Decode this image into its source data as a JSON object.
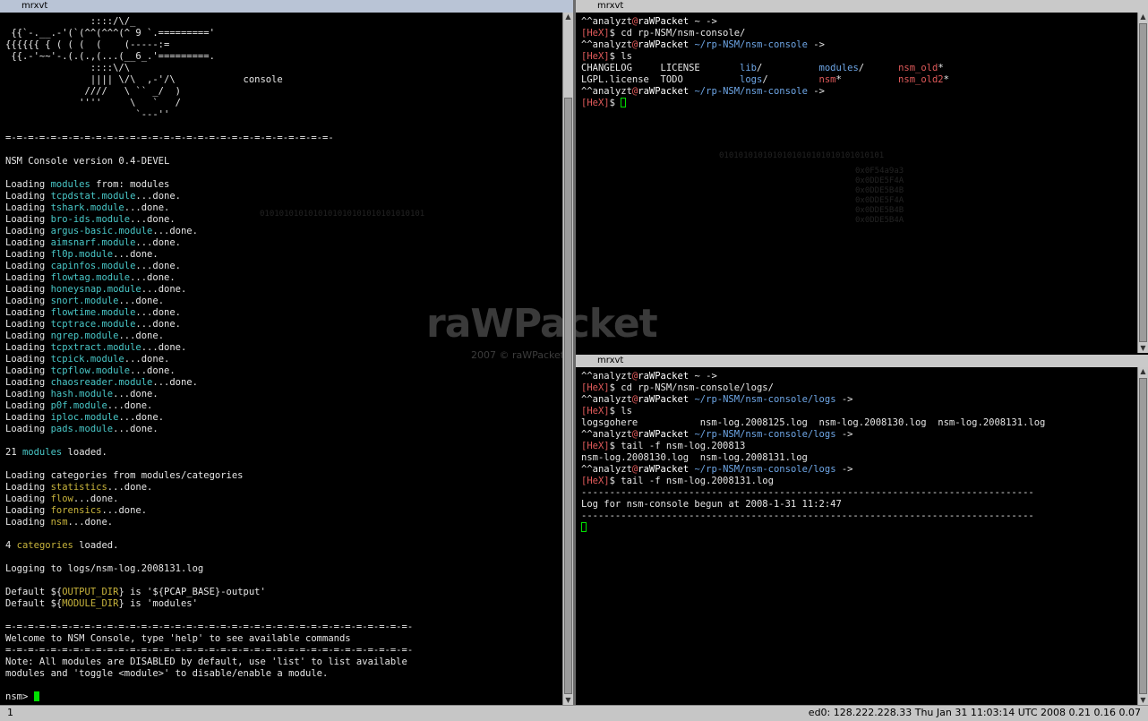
{
  "colors": {
    "module": "#49c8c8",
    "category": "#c8b43c",
    "bracket": "#e05a5a",
    "hex": "#e05a5a",
    "path": "#6ea6e6",
    "user": "#e6e6e6",
    "at": "#e05a5a",
    "host": "#ffffff",
    "dir": "#6ea6e6",
    "exec": "#e05a5a"
  },
  "left": {
    "title": "mrxvt",
    "lines": [
      [
        {
          "t": "               ::::/\\/_"
        }
      ],
      [
        {
          "t": " {{`-.__.-'(`(^^(^^^(^ 9 `.========='"
        }
      ],
      [
        {
          "t": "{{{{{{ { ( ( (  (    (-----:="
        }
      ],
      [
        {
          "t": " {{.-'~~'-.(.(.,(...(__6_.'=========."
        }
      ],
      [
        {
          "t": "               ::::\\/\\"
        }
      ],
      [
        {
          "t": "               |||| \\/\\  ,-'/\\            console"
        }
      ],
      [
        {
          "t": "              ////   \\ `` _/  )"
        }
      ],
      [
        {
          "t": "             ''''     \\   `   /"
        }
      ],
      [
        {
          "t": "                       `---''"
        }
      ],
      [
        {
          "t": ""
        }
      ],
      [
        {
          "t": "=-=-=-=-=-=-=-=-=-=-=-=-=-=-=-=-=-=-=-=-=-=-=-=-=-=-=-=-=-"
        }
      ],
      [
        {
          "t": ""
        }
      ],
      [
        {
          "t": "NSM Console version 0.4-DEVEL"
        }
      ],
      [
        {
          "t": ""
        }
      ],
      [
        {
          "t": "Loading "
        },
        {
          "t": "modules",
          "c": "module"
        },
        {
          "t": " from: modules"
        }
      ],
      [
        {
          "t": "Loading "
        },
        {
          "t": "tcpdstat.module",
          "c": "module"
        },
        {
          "t": "...done."
        }
      ],
      [
        {
          "t": "Loading "
        },
        {
          "t": "tshark.module",
          "c": "module"
        },
        {
          "t": "...done."
        }
      ],
      [
        {
          "t": "Loading "
        },
        {
          "t": "bro-ids.module",
          "c": "module"
        },
        {
          "t": "...done."
        }
      ],
      [
        {
          "t": "Loading "
        },
        {
          "t": "argus-basic.module",
          "c": "module"
        },
        {
          "t": "...done."
        }
      ],
      [
        {
          "t": "Loading "
        },
        {
          "t": "aimsnarf.module",
          "c": "module"
        },
        {
          "t": "...done."
        }
      ],
      [
        {
          "t": "Loading "
        },
        {
          "t": "fl0p.module",
          "c": "module"
        },
        {
          "t": "...done."
        }
      ],
      [
        {
          "t": "Loading "
        },
        {
          "t": "capinfos.module",
          "c": "module"
        },
        {
          "t": "...done."
        }
      ],
      [
        {
          "t": "Loading "
        },
        {
          "t": "flowtag.module",
          "c": "module"
        },
        {
          "t": "...done."
        }
      ],
      [
        {
          "t": "Loading "
        },
        {
          "t": "honeysnap.module",
          "c": "module"
        },
        {
          "t": "...done."
        }
      ],
      [
        {
          "t": "Loading "
        },
        {
          "t": "snort.module",
          "c": "module"
        },
        {
          "t": "...done."
        }
      ],
      [
        {
          "t": "Loading "
        },
        {
          "t": "flowtime.module",
          "c": "module"
        },
        {
          "t": "...done."
        }
      ],
      [
        {
          "t": "Loading "
        },
        {
          "t": "tcptrace.module",
          "c": "module"
        },
        {
          "t": "...done."
        }
      ],
      [
        {
          "t": "Loading "
        },
        {
          "t": "ngrep.module",
          "c": "module"
        },
        {
          "t": "...done."
        }
      ],
      [
        {
          "t": "Loading "
        },
        {
          "t": "tcpxtract.module",
          "c": "module"
        },
        {
          "t": "...done."
        }
      ],
      [
        {
          "t": "Loading "
        },
        {
          "t": "tcpick.module",
          "c": "module"
        },
        {
          "t": "...done."
        }
      ],
      [
        {
          "t": "Loading "
        },
        {
          "t": "tcpflow.module",
          "c": "module"
        },
        {
          "t": "...done."
        }
      ],
      [
        {
          "t": "Loading "
        },
        {
          "t": "chaosreader.module",
          "c": "module"
        },
        {
          "t": "...done."
        }
      ],
      [
        {
          "t": "Loading "
        },
        {
          "t": "hash.module",
          "c": "module"
        },
        {
          "t": "...done."
        }
      ],
      [
        {
          "t": "Loading "
        },
        {
          "t": "p0f.module",
          "c": "module"
        },
        {
          "t": "...done."
        }
      ],
      [
        {
          "t": "Loading "
        },
        {
          "t": "iploc.module",
          "c": "module"
        },
        {
          "t": "...done."
        }
      ],
      [
        {
          "t": "Loading "
        },
        {
          "t": "pads.module",
          "c": "module"
        },
        {
          "t": "...done."
        }
      ],
      [
        {
          "t": ""
        }
      ],
      [
        {
          "t": "21 "
        },
        {
          "t": "modules",
          "c": "module"
        },
        {
          "t": " loaded."
        }
      ],
      [
        {
          "t": ""
        }
      ],
      [
        {
          "t": "Loading categories from modules/categories"
        }
      ],
      [
        {
          "t": "Loading "
        },
        {
          "t": "statistics",
          "c": "category"
        },
        {
          "t": "...done."
        }
      ],
      [
        {
          "t": "Loading "
        },
        {
          "t": "flow",
          "c": "category"
        },
        {
          "t": "...done."
        }
      ],
      [
        {
          "t": "Loading "
        },
        {
          "t": "forensics",
          "c": "category"
        },
        {
          "t": "...done."
        }
      ],
      [
        {
          "t": "Loading "
        },
        {
          "t": "nsm",
          "c": "category"
        },
        {
          "t": "...done."
        }
      ],
      [
        {
          "t": ""
        }
      ],
      [
        {
          "t": "4 "
        },
        {
          "t": "categories",
          "c": "category"
        },
        {
          "t": " loaded."
        }
      ],
      [
        {
          "t": ""
        }
      ],
      [
        {
          "t": "Logging to logs/nsm-log.2008131.log"
        }
      ],
      [
        {
          "t": ""
        }
      ],
      [
        {
          "t": "Default ${"
        },
        {
          "t": "OUTPUT_DIR",
          "c": "category"
        },
        {
          "t": "} is '${PCAP_BASE}-output'"
        }
      ],
      [
        {
          "t": "Default ${"
        },
        {
          "t": "MODULE_DIR",
          "c": "category"
        },
        {
          "t": "} is 'modules'"
        }
      ],
      [
        {
          "t": ""
        }
      ],
      [
        {
          "t": "=-=-=-=-=-=-=-=-=-=-=-=-=-=-=-=-=-=-=-=-=-=-=-=-=-=-=-=-=-=-=-=-=-=-=-=-"
        }
      ],
      [
        {
          "t": "Welcome to NSM Console, type 'help' to see available commands"
        }
      ],
      [
        {
          "t": "=-=-=-=-=-=-=-=-=-=-=-=-=-=-=-=-=-=-=-=-=-=-=-=-=-=-=-=-=-=-=-=-=-=-=-=-"
        }
      ],
      [
        {
          "t": "Note: All modules are DISABLED by default, use 'list' to list available"
        }
      ],
      [
        {
          "t": "modules and 'toggle <module>' to disable/enable a module."
        }
      ],
      [
        {
          "t": ""
        }
      ],
      [
        {
          "t": "nsm> "
        },
        {
          "cursor": "solid"
        }
      ]
    ]
  },
  "topright": {
    "title": "mrxvt",
    "lines": [
      [
        {
          "t": "^^"
        },
        {
          "t": "analyzt",
          "c": "user"
        },
        {
          "t": "@",
          "c": "at"
        },
        {
          "t": "raWPacket",
          "c": "host"
        },
        {
          "t": " ~ ->"
        }
      ],
      [
        {
          "t": "[",
          "c": "bracket"
        },
        {
          "t": "HeX",
          "c": "hex"
        },
        {
          "t": "]",
          "c": "bracket"
        },
        {
          "t": "$ cd rp-NSM/nsm-console/"
        }
      ],
      [
        {
          "t": "^^"
        },
        {
          "t": "analyzt",
          "c": "user"
        },
        {
          "t": "@",
          "c": "at"
        },
        {
          "t": "raWPacket",
          "c": "host"
        },
        {
          "t": " ~/rp-NSM/nsm-console",
          "c": "path"
        },
        {
          "t": " ->"
        }
      ],
      [
        {
          "t": "[",
          "c": "bracket"
        },
        {
          "t": "HeX",
          "c": "hex"
        },
        {
          "t": "]",
          "c": "bracket"
        },
        {
          "t": "$ ls"
        }
      ],
      [
        {
          "t": "CHANGELOG     LICENSE       "
        },
        {
          "t": "lib",
          "c": "dir"
        },
        {
          "t": "/          "
        },
        {
          "t": "modules",
          "c": "dir"
        },
        {
          "t": "/      "
        },
        {
          "t": "nsm_old",
          "c": "exec"
        },
        {
          "t": "*"
        }
      ],
      [
        {
          "t": "LGPL.license  TODO          "
        },
        {
          "t": "logs",
          "c": "dir"
        },
        {
          "t": "/         "
        },
        {
          "t": "nsm",
          "c": "exec"
        },
        {
          "t": "*          "
        },
        {
          "t": "nsm_old2",
          "c": "exec"
        },
        {
          "t": "*"
        }
      ],
      [
        {
          "t": "^^"
        },
        {
          "t": "analyzt",
          "c": "user"
        },
        {
          "t": "@",
          "c": "at"
        },
        {
          "t": "raWPacket",
          "c": "host"
        },
        {
          "t": " ~/rp-NSM/nsm-console",
          "c": "path"
        },
        {
          "t": " ->"
        }
      ],
      [
        {
          "t": "[",
          "c": "bracket"
        },
        {
          "t": "HeX",
          "c": "hex"
        },
        {
          "t": "]",
          "c": "bracket"
        },
        {
          "t": "$ "
        },
        {
          "cursor": "hollow"
        }
      ]
    ]
  },
  "bottomright": {
    "title": "mrxvt",
    "lines": [
      [
        {
          "t": "^^"
        },
        {
          "t": "analyzt",
          "c": "user"
        },
        {
          "t": "@",
          "c": "at"
        },
        {
          "t": "raWPacket",
          "c": "host"
        },
        {
          "t": " ~ ->"
        }
      ],
      [
        {
          "t": "[",
          "c": "bracket"
        },
        {
          "t": "HeX",
          "c": "hex"
        },
        {
          "t": "]",
          "c": "bracket"
        },
        {
          "t": "$ cd rp-NSM/nsm-console/logs/"
        }
      ],
      [
        {
          "t": "^^"
        },
        {
          "t": "analyzt",
          "c": "user"
        },
        {
          "t": "@",
          "c": "at"
        },
        {
          "t": "raWPacket",
          "c": "host"
        },
        {
          "t": " ~/rp-NSM/nsm-console/logs",
          "c": "path"
        },
        {
          "t": " ->"
        }
      ],
      [
        {
          "t": "[",
          "c": "bracket"
        },
        {
          "t": "HeX",
          "c": "hex"
        },
        {
          "t": "]",
          "c": "bracket"
        },
        {
          "t": "$ ls"
        }
      ],
      [
        {
          "t": "logsgohere           nsm-log.2008125.log  nsm-log.2008130.log  nsm-log.2008131.log"
        }
      ],
      [
        {
          "t": "^^"
        },
        {
          "t": "analyzt",
          "c": "user"
        },
        {
          "t": "@",
          "c": "at"
        },
        {
          "t": "raWPacket",
          "c": "host"
        },
        {
          "t": " ~/rp-NSM/nsm-console/logs",
          "c": "path"
        },
        {
          "t": " ->"
        }
      ],
      [
        {
          "t": "[",
          "c": "bracket"
        },
        {
          "t": "HeX",
          "c": "hex"
        },
        {
          "t": "]",
          "c": "bracket"
        },
        {
          "t": "$ tail -f nsm-log.200813"
        }
      ],
      [
        {
          "t": "nsm-log.2008130.log  nsm-log.2008131.log"
        }
      ],
      [
        {
          "t": "^^"
        },
        {
          "t": "analyzt",
          "c": "user"
        },
        {
          "t": "@",
          "c": "at"
        },
        {
          "t": "raWPacket",
          "c": "host"
        },
        {
          "t": " ~/rp-NSM/nsm-console/logs",
          "c": "path"
        },
        {
          "t": " ->"
        }
      ],
      [
        {
          "t": "[",
          "c": "bracket"
        },
        {
          "t": "HeX",
          "c": "hex"
        },
        {
          "t": "]",
          "c": "bracket"
        },
        {
          "t": "$ tail -f nsm-log.2008131.log"
        }
      ],
      [
        {
          "t": "--------------------------------------------------------------------------------"
        }
      ],
      [
        {
          "t": "Log for nsm-console begun at 2008-1-31 11:2:47"
        }
      ],
      [
        {
          "t": "--------------------------------------------------------------------------------"
        }
      ],
      [
        {
          "cursor": "hollow"
        }
      ]
    ]
  },
  "wallpaper": {
    "logo": "raWPacket",
    "copyright": "2007 © raWPacket",
    "binary": "0101010101010101010101010101010101",
    "hexcol": [
      "0x0F54a9a3",
      "0x0DDE5F4A",
      "0x0DDE5B4B",
      "0x0DDE5F4A",
      "0x0DDE5B4B",
      "0x0DDE5B4A"
    ]
  },
  "statusbar": {
    "left": "1",
    "right": "ed0: 128.222.228.33 Thu Jan 31 11:03:14 UTC 2008 0.21 0.16 0.07"
  }
}
